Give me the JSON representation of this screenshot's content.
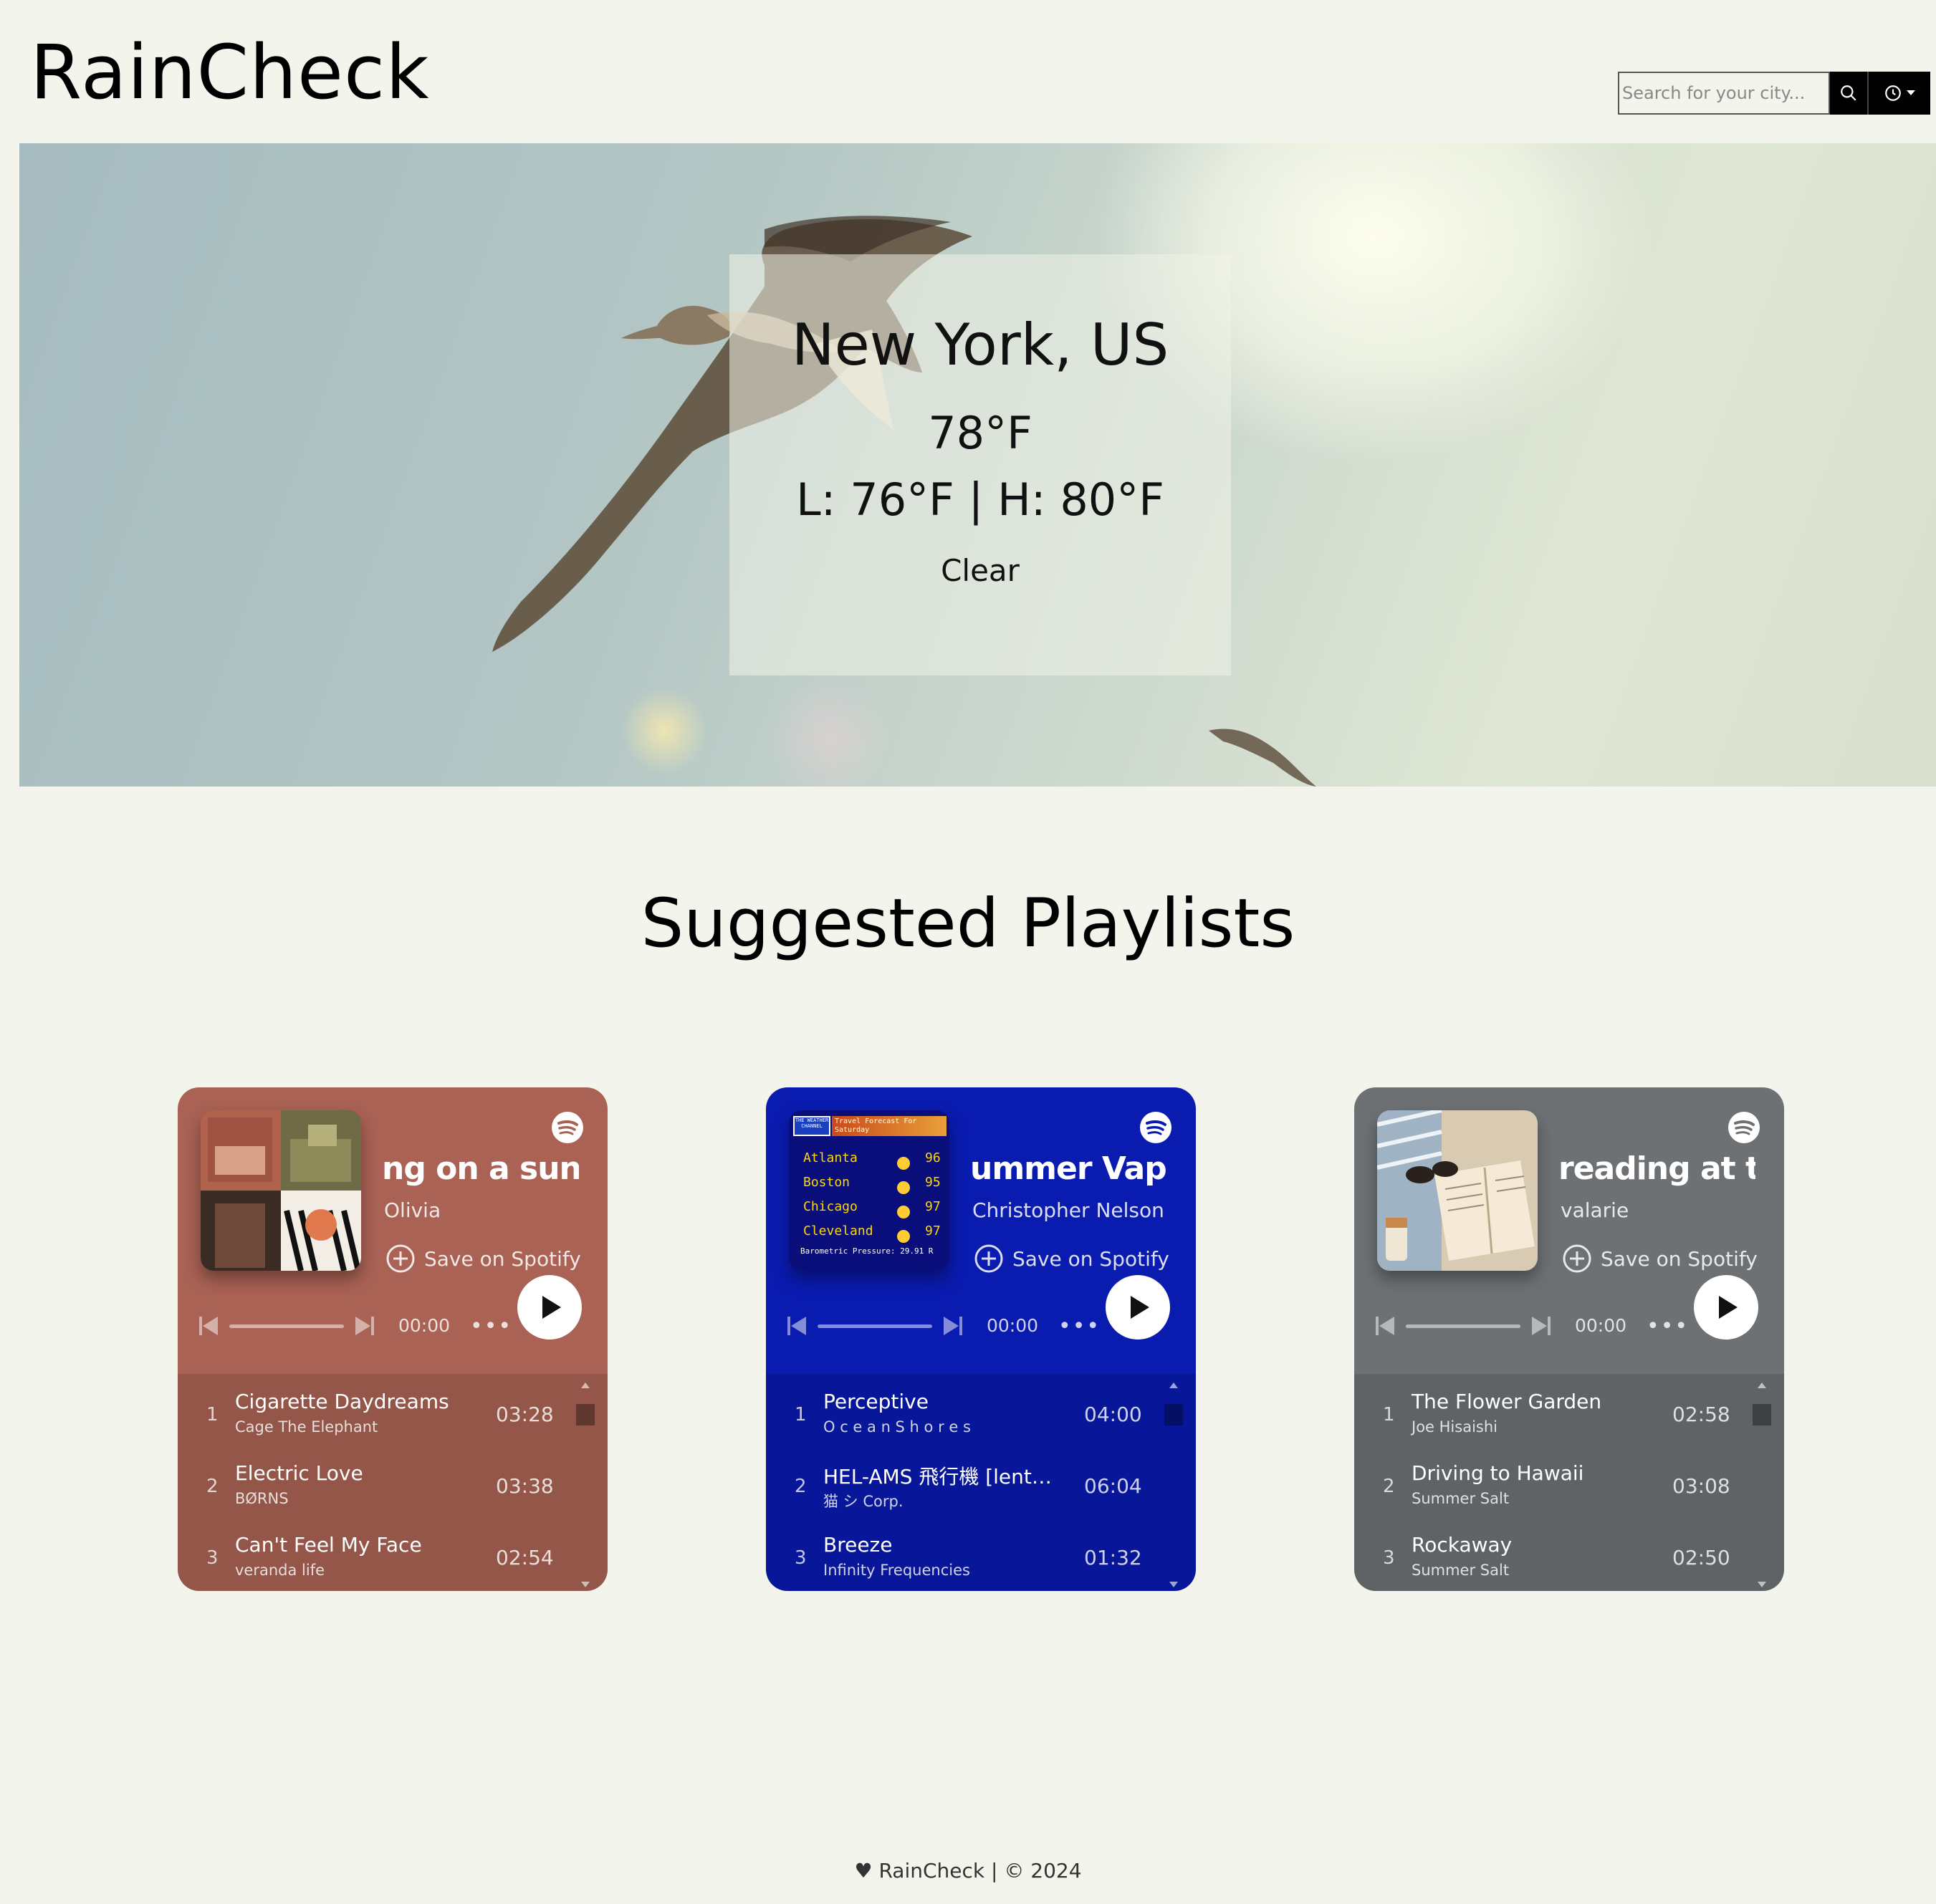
{
  "header": {
    "brand": "RainCheck",
    "search_placeholder": "Search for your city..."
  },
  "weather": {
    "city": "New York, US",
    "temp": "78°F",
    "range": "L: 76°F | H: 80°F",
    "condition": "Clear"
  },
  "section_title": "Suggested Playlists",
  "playlists": [
    {
      "name": "ng on a sunny s",
      "owner": "Olivia",
      "save_label": "Save on Spotify",
      "time": "00:00",
      "bg": "#a96254",
      "tracks": [
        {
          "num": "1",
          "title": "Cigarette Daydreams",
          "artist": "Cage The Elephant",
          "dur": "03:28"
        },
        {
          "num": "2",
          "title": "Electric Love",
          "artist": "BØRNS",
          "dur": "03:38"
        },
        {
          "num": "3",
          "title": "Can't Feel My Face",
          "artist": "veranda life",
          "dur": "02:54"
        }
      ]
    },
    {
      "name": "ummer Vapor",
      "owner": "Christopher Nelson",
      "save_label": "Save on Spotify",
      "time": "00:00",
      "bg": "#0a1bb0",
      "cover": {
        "logo": "THE WEATHER CHANNEL",
        "header": "Travel Forecast For Saturday",
        "cities": [
          "Atlanta",
          "Boston",
          "Chicago",
          "Cleveland"
        ],
        "highs": [
          "96",
          "95",
          "97",
          "97"
        ],
        "footer": "Barometric Pressure: 29.91 R"
      },
      "tracks": [
        {
          "num": "1",
          "title": "Perceptive",
          "artist": "O c e a n  S h o r e s",
          "dur": "04:00"
        },
        {
          "num": "2",
          "title": "HEL-AMS 飛行機 [lentoke...",
          "artist": "猫 シ Corp.",
          "dur": "06:04"
        },
        {
          "num": "3",
          "title": "Breeze",
          "artist": "Infinity Frequencies",
          "dur": "01:32"
        }
      ]
    },
    {
      "name": "reading at the",
      "owner": "valarie",
      "save_label": "Save on Spotify",
      "time": "00:00",
      "bg": "#6e7174",
      "tracks": [
        {
          "num": "1",
          "title": "The Flower Garden",
          "artist": "Joe Hisaishi",
          "dur": "02:58"
        },
        {
          "num": "2",
          "title": "Driving to Hawaii",
          "artist": "Summer Salt",
          "dur": "03:08"
        },
        {
          "num": "3",
          "title": "Rockaway",
          "artist": "Summer Salt",
          "dur": "02:50"
        }
      ]
    }
  ],
  "footer": "♥ RainCheck | © 2024"
}
